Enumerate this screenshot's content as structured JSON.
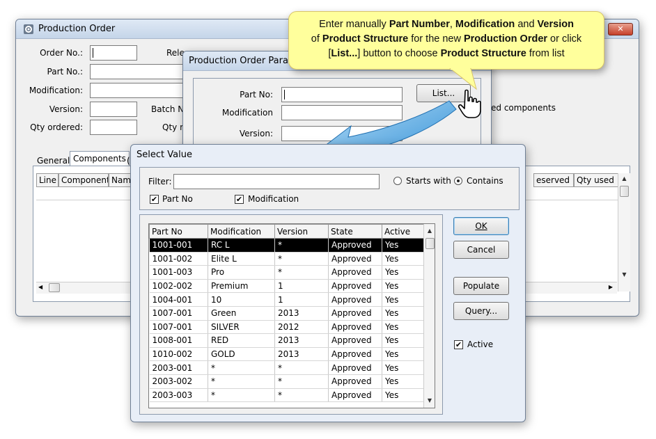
{
  "production_order": {
    "title": "Production Order",
    "order_no_label": "Order No.:",
    "release_label": "Rele",
    "part_no_label": "Part No.:",
    "modification_label": "Modification:",
    "version_label": "Version:",
    "batch_no_label": "Batch No",
    "qty_ordered_label": "Qty ordered:",
    "qty_re_label": "Qty re",
    "reserved_components_text": "ed components",
    "tabs": [
      "General",
      "Components",
      "("
    ],
    "columns": [
      "Line",
      "Component",
      "Name",
      "eserved",
      "Qty used"
    ]
  },
  "param_dialog": {
    "title": "Production Order Param",
    "part_no_label": "Part No:",
    "modification_label": "Modification",
    "version_label": "Version:",
    "list_button": "List..."
  },
  "callout": {
    "line1_pre": "Enter manually ",
    "line1_b1": "Part Number",
    "line1_mid1": ", ",
    "line1_b2": "Modification",
    "line1_mid2": " and ",
    "line1_b3": "Version",
    "line2_pre": "of ",
    "line2_b1": "Product Structure",
    "line2_mid": " for the new ",
    "line2_b2": "Production Order",
    "line2_post": " or click",
    "line3_pre": "[",
    "line3_b1": "List...",
    "line3_mid": "] button to choose ",
    "line3_b2": "Product Structure",
    "line3_post": " from list"
  },
  "select_value": {
    "title": "Select Value",
    "filter_label": "Filter:",
    "filter_value": "",
    "starts_with_label": "Starts with",
    "contains_label": "Contains",
    "match_mode": "Contains",
    "part_no_check_label": "Part No",
    "part_no_checked": true,
    "modification_check_label": "Modification",
    "modification_checked": true,
    "columns": [
      "Part No",
      "Modification",
      "Version",
      "State",
      "Active"
    ],
    "rows": [
      [
        "1001-001",
        "RC L",
        "*",
        "Approved",
        "Yes"
      ],
      [
        "1001-002",
        "Elite L",
        "*",
        "Approved",
        "Yes"
      ],
      [
        "1001-003",
        "Pro",
        "*",
        "Approved",
        "Yes"
      ],
      [
        "1002-002",
        "Premium",
        "1",
        "Approved",
        "Yes"
      ],
      [
        "1004-001",
        "10",
        "1",
        "Approved",
        "Yes"
      ],
      [
        "1007-001",
        "Green",
        "2013",
        "Approved",
        "Yes"
      ],
      [
        "1007-001",
        "SILVER",
        "2012",
        "Approved",
        "Yes"
      ],
      [
        "1008-001",
        "RED",
        "2013",
        "Approved",
        "Yes"
      ],
      [
        "1010-002",
        "GOLD",
        "2013",
        "Approved",
        "Yes"
      ],
      [
        "2003-001",
        "*",
        "*",
        "Approved",
        "Yes"
      ],
      [
        "2003-002",
        "*",
        "*",
        "Approved",
        "Yes"
      ],
      [
        "2003-003",
        "*",
        "*",
        "Approved",
        "Yes"
      ]
    ],
    "selected_row": 0,
    "buttons": {
      "ok": "OK",
      "cancel": "Cancel",
      "populate": "Populate",
      "query": "Query..."
    },
    "active_label": "Active",
    "active_checked": true
  },
  "colors": {
    "callout_bg": "#ffff9c",
    "arrow": "#2f8fd6",
    "selection": "#000000"
  }
}
